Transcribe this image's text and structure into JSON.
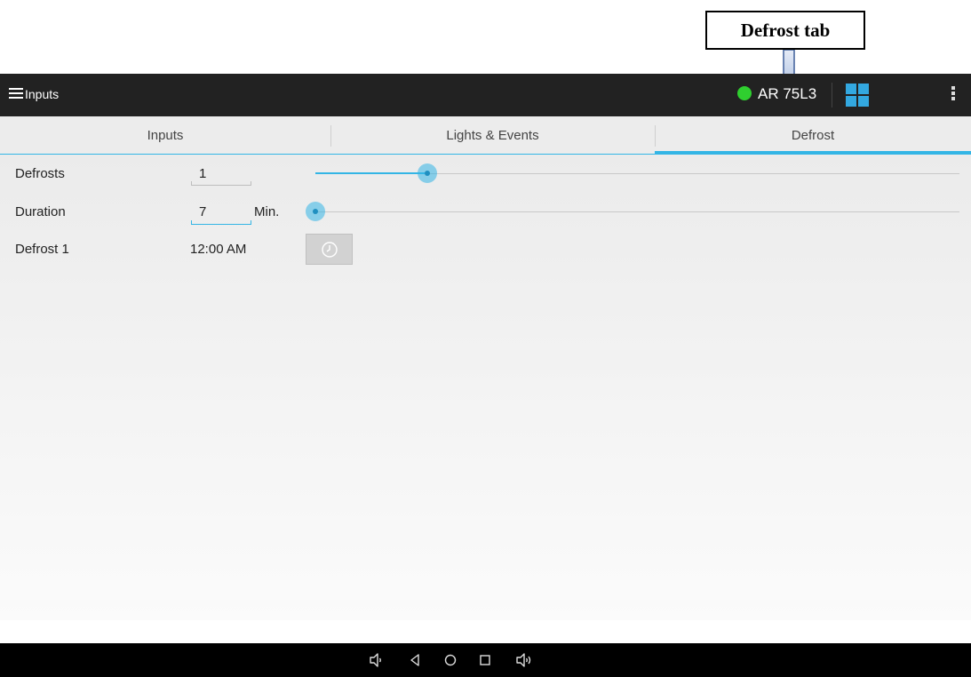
{
  "annotation": {
    "label": "Defrost tab"
  },
  "actionbar": {
    "title": "Inputs",
    "device_id": "AR 75L3"
  },
  "tabs": [
    {
      "label": "Inputs",
      "selected": false
    },
    {
      "label": "Lights & Events",
      "selected": false
    },
    {
      "label": "Defrost",
      "selected": true
    }
  ],
  "settings": {
    "defrosts": {
      "label": "Defrosts",
      "value": "1",
      "slider_fraction": 0.17
    },
    "duration": {
      "label": "Duration",
      "value": "7",
      "unit": "Min.",
      "slider_fraction": 0.0
    },
    "defrost1": {
      "label": "Defrost 1",
      "time": "12:00 AM"
    }
  },
  "colors": {
    "accent": "#33b5e5",
    "status": "#2fcf2f",
    "actionbar": "#222222"
  },
  "navbar": {
    "icons": [
      "volume-down-icon",
      "back-icon",
      "home-icon",
      "recents-icon",
      "volume-up-icon"
    ]
  }
}
